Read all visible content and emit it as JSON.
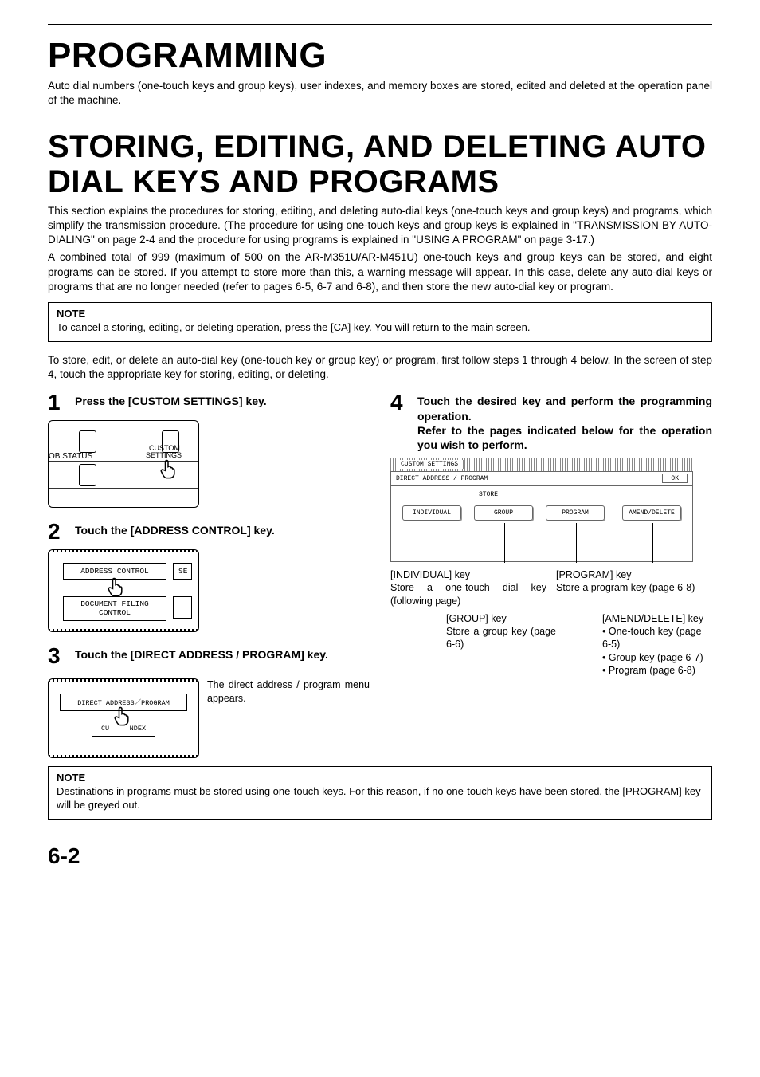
{
  "title_main": "PROGRAMMING",
  "intro_main": "Auto dial numbers (one-touch keys and group keys), user indexes, and memory boxes are stored, edited and deleted at the operation panel of the machine.",
  "title_section": "STORING, EDITING, AND DELETING AUTO DIAL KEYS AND PROGRAMS",
  "section_p1": "This section explains the procedures for storing, editing, and deleting auto-dial keys (one-touch keys and group keys) and programs, which simplify the transmission procedure. (The procedure for using one-touch keys and group keys is explained in \"TRANSMISSION BY AUTO-DIALING\" on page 2-4 and the procedure for using programs is explained in \"USING A PROGRAM\" on page 3-17.)",
  "section_p2": "A combined total of 999 (maximum of 500 on the AR-M351U/AR-M451U) one-touch keys and group keys can be stored, and eight programs can be stored. If you attempt to store more than this, a warning message will appear. In this case, delete any auto-dial keys or programs that are no longer needed (refer to pages 6-5, 6-7 and 6-8), and then store the new auto-dial key or program.",
  "note1_label": "NOTE",
  "note1_text": "To cancel a storing, editing, or deleting operation, press the [CA] key. You will return to the main screen.",
  "lead_in": "To store, edit, or delete an auto-dial key (one-touch key or group key) or program, first follow steps 1 through 4 below. In the screen of step 4, touch the appropriate key for storing, editing, or deleting.",
  "steps": {
    "s1_num": "1",
    "s1_title": "Press the [CUSTOM SETTINGS] key.",
    "s1_il_jobstatus": "OB STATUS",
    "s1_il_custom_l1": "CUSTOM",
    "s1_il_custom_l2": "SETTINGS",
    "s2_num": "2",
    "s2_title": "Touch the [ADDRESS CONTROL] key.",
    "s2_il_btn1": "ADDRESS CONTROL",
    "s2_il_btn1b": "SE",
    "s2_il_btn2": "DOCUMENT FILING CONTROL",
    "s3_num": "3",
    "s3_title": "Touch the [DIRECT ADDRESS / PROGRAM] key.",
    "s3_side": "The direct address / program menu appears.",
    "s3_il_btn1": "DIRECT ADDRESS／PROGRAM",
    "s3_il_btn2a": "CU",
    "s3_il_btn2b": "NDEX",
    "s4_num": "4",
    "s4_title": "Touch the desired key and perform the programming operation.\nRefer to the pages indicated below for the operation you wish to perform.",
    "s4_il_tab": "CUSTOM SETTINGS",
    "s4_il_row": "DIRECT ADDRESS / PROGRAM",
    "s4_il_ok": "OK",
    "s4_il_store": "STORE",
    "s4_il_b1": "INDIVIDUAL",
    "s4_il_b2": "GROUP",
    "s4_il_b3": "PROGRAM",
    "s4_il_b4": "AMEND/DELETE"
  },
  "keys": {
    "indiv_h": "[INDIVIDUAL] key",
    "indiv_t": "Store a one-touch dial key (following page)",
    "prog_h": "[PROGRAM] key",
    "prog_t": "Store a program key (page 6-8)",
    "group_h": "[GROUP] key",
    "group_t": "Store a group key (page 6-6)",
    "amend_h": "[AMEND/DELETE] key",
    "amend_b1": "• One-touch key (page 6-5)",
    "amend_b2": "• Group key (page 6-7)",
    "amend_b3": "• Program (page 6-8)"
  },
  "note2_label": "NOTE",
  "note2_text": "Destinations in programs must be stored using one-touch keys. For this reason, if no one-touch keys have been stored, the [PROGRAM] key will be greyed out.",
  "page_number": "6-2"
}
